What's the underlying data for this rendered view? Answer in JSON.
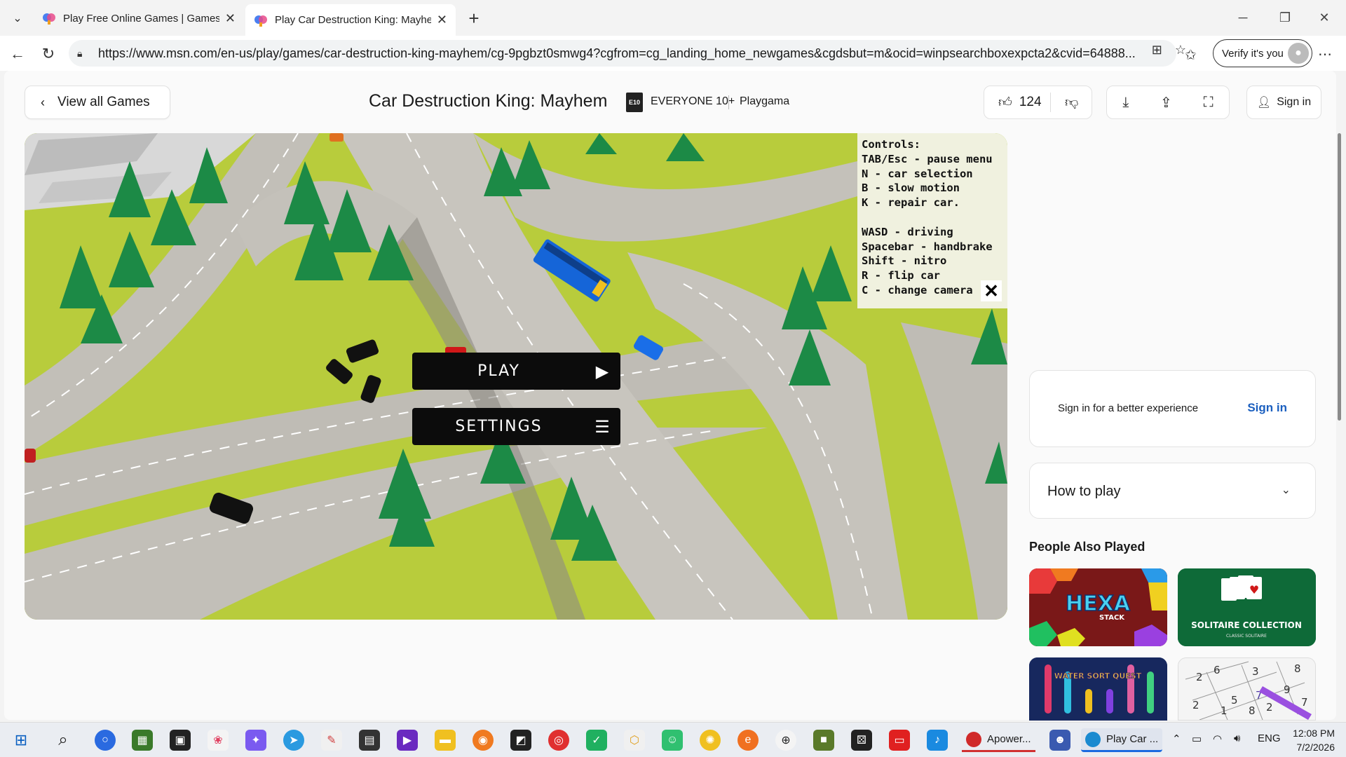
{
  "browser": {
    "tabs": [
      {
        "title": "Play Free Online Games | Games fr",
        "active": false
      },
      {
        "title": "Play Car Destruction King: Mayhem",
        "active": true
      }
    ],
    "url": "https://www.msn.com/en-us/play/games/car-destruction-king-mayhem/cg-9pgbzt0smwg4?cgfrom=cg_landing_home_newgames&cgdsbut=m&ocid=winpsearchboxexpcta2&cvid=64888...",
    "verify_label": "Verify it's you"
  },
  "header": {
    "back_label": "View all Games",
    "title": "Car Destruction King: Mayhem",
    "rating": "EVERYONE 10+",
    "publisher": "Playgama",
    "likes": "124",
    "signin_label": "Sign in"
  },
  "game": {
    "controls_text": "Controls:\nTAB/Esc - pause menu\nN - car selection\nB - slow motion\nK - repair car.\n\nWASD - driving\nSpacebar - handbrake\nShift - nitro\nR - flip car\nC - change camera",
    "play_label": "PLAY",
    "settings_label": "SETTINGS"
  },
  "sidebar": {
    "signin_message": "Sign in for a better experience",
    "signin_link": "Sign in",
    "howto_label": "How to play",
    "people_title": "People Also Played",
    "thumbs": [
      {
        "title": "HEXA",
        "subtitle": "STACK"
      },
      {
        "title": "SOLITAIRE COLLECTION",
        "subtitle": "CLASSIC SOLITAIRE"
      },
      {
        "title": "WATER SORT QUEST",
        "subtitle": ""
      },
      {
        "title": "",
        "subtitle": ""
      }
    ]
  },
  "taskbar": {
    "apps": [
      {
        "label": "Apower..."
      },
      {
        "label": "Play Car ..."
      }
    ],
    "language": "ENG",
    "time": "12:08 PM",
    "date": "7/2/2026"
  },
  "colors": {
    "accent_link": "#1b5fbf",
    "grass": "#c8d84a",
    "road": "#bdbab3",
    "tree": "#1d8a4a",
    "bus": "#1565d8"
  }
}
